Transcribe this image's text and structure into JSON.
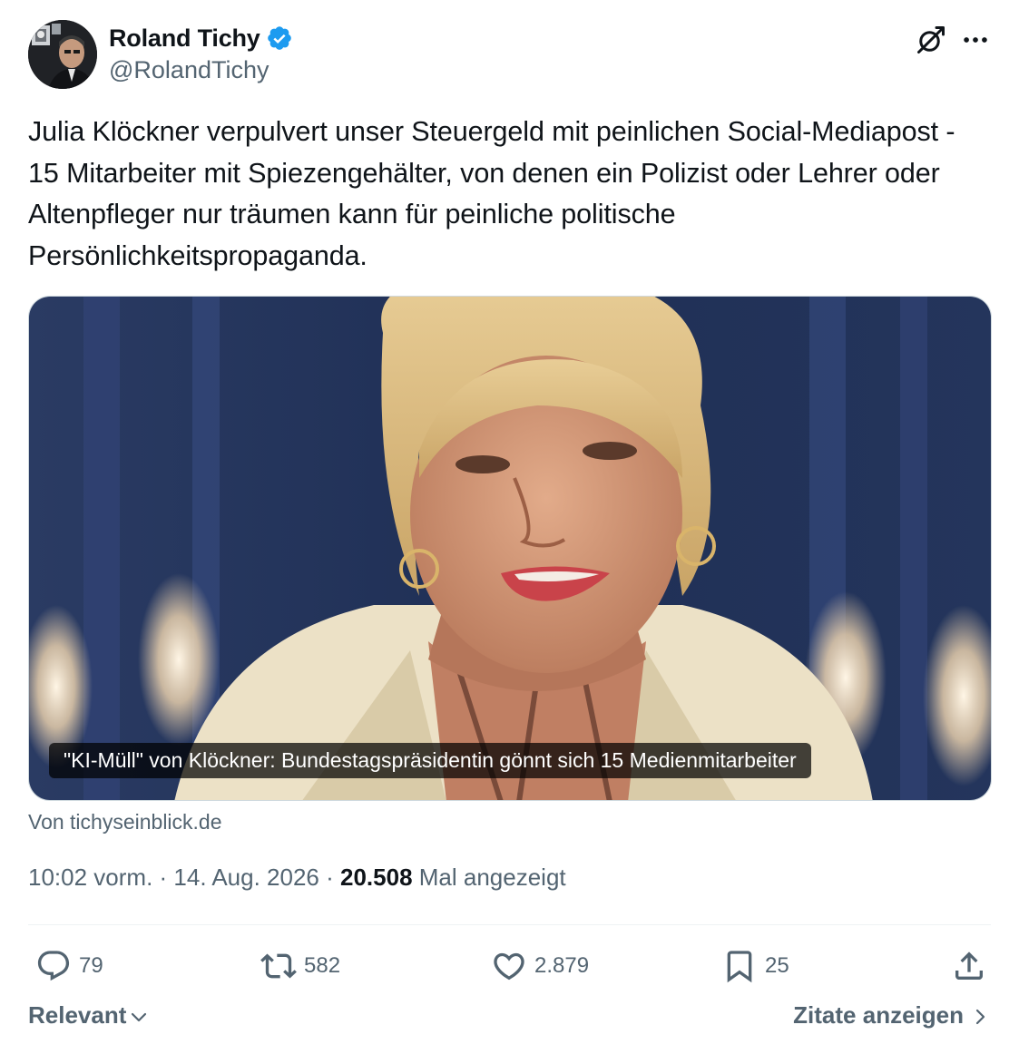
{
  "author": {
    "display_name": "Roland Tichy",
    "handle": "@RolandTichy",
    "verified": true
  },
  "icons": {
    "verified": "verified-badge-icon",
    "grok": "grok-icon",
    "more": "more-icon",
    "reply": "reply-icon",
    "repost": "repost-icon",
    "like": "heart-icon",
    "bookmark": "bookmark-icon",
    "share": "share-icon"
  },
  "tweet": {
    "text": "Julia Klöckner verpulvert unser Steuergeld mit peinlichen Social-Mediapost - 15 Mitarbeiter mit Spiezengehälter, von denen ein Polizist oder Lehrer oder Altenpfleger nur träumen kann für peinliche politische Persönlichkeitspropaganda."
  },
  "card": {
    "caption": "\"KI-Müll\" von Klöckner: Bundestagspräsidentin gönnt sich 15 Medienmitarbeiter",
    "source": "Von tichyseinblick.de"
  },
  "meta": {
    "time": "10:02 vorm.",
    "separator": " · ",
    "date": "14. Aug. 2026",
    "views_count": "20.508",
    "views_label": " Mal angezeigt"
  },
  "actions": {
    "replies": "79",
    "reposts": "582",
    "likes": "2.879",
    "bookmarks": "25"
  },
  "footer": {
    "sort_label": "Relevant",
    "quotes_label": "Zitate anzeigen"
  },
  "colors": {
    "text": "#0f1419",
    "secondary": "#536471",
    "verified": "#1d9bf0",
    "divider": "#eff3f4"
  }
}
